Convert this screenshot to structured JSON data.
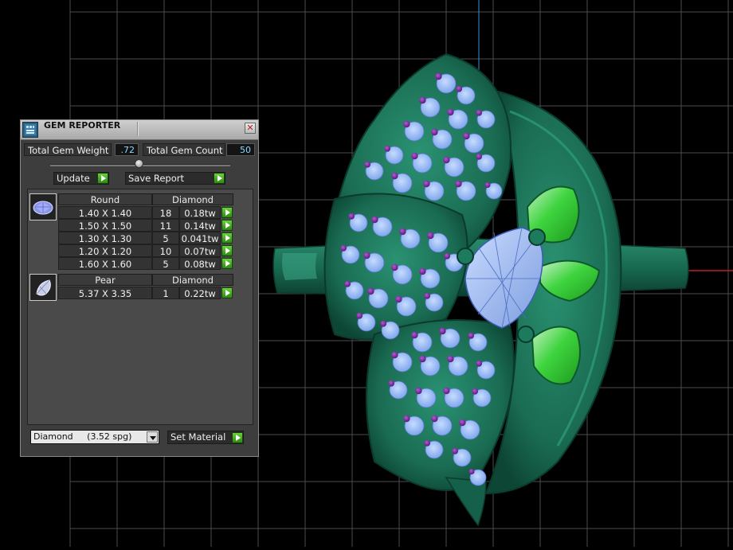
{
  "panel": {
    "title": "GEM REPORTER",
    "close_glyph": "✕",
    "total_weight_label": "Total Gem Weight",
    "total_weight_value": ".72",
    "total_count_label": "Total Gem Count",
    "total_count_value": "50",
    "update_label": "Update",
    "save_report_label": "Save Report",
    "groups": [
      {
        "shape": "Round",
        "material": "Diamond",
        "rows": [
          {
            "size": "1.40 X 1.40",
            "count": "18",
            "weight": "0.18tw"
          },
          {
            "size": "1.50 X 1.50",
            "count": "11",
            "weight": "0.14tw"
          },
          {
            "size": "1.30 X 1.30",
            "count": "5",
            "weight": "0.041tw"
          },
          {
            "size": "1.20 X 1.20",
            "count": "10",
            "weight": "0.07tw"
          },
          {
            "size": "1.60 X 1.60",
            "count": "5",
            "weight": "0.08tw"
          }
        ]
      },
      {
        "shape": "Pear",
        "material": "Diamond",
        "rows": [
          {
            "size": "5.37 X 3.35",
            "count": "1",
            "weight": "0.22tw"
          }
        ]
      }
    ],
    "material_select": "Diamond     (3.52 spg)",
    "set_material_label": "Set Material"
  },
  "colors": {
    "metal": "#1f7a5e",
    "metal_dark": "#0e4c39",
    "gem_blue": "#8fb6f2",
    "prong_purple": "#7d2aa6",
    "green_stone": "#3bd63b",
    "grid": "#555555",
    "axis_blue": "#3a8fd0",
    "axis_red": "#c02020"
  },
  "icons": [
    "gem-reporter-app-icon",
    "close-icon",
    "play-icon",
    "round-gem-icon",
    "pear-gem-icon",
    "dropdown-arrow-icon"
  ]
}
